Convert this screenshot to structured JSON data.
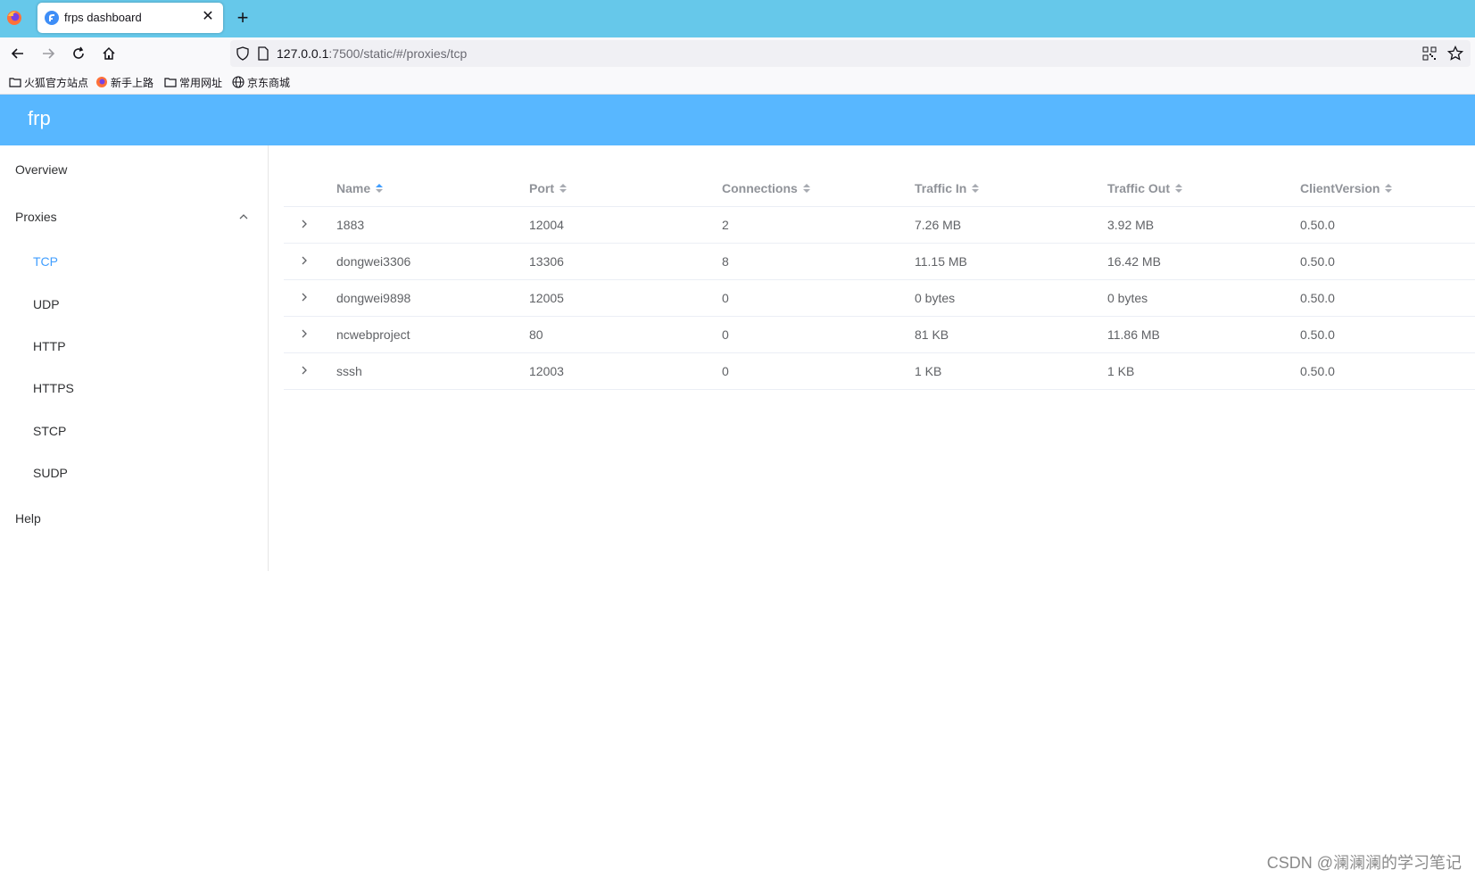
{
  "browser": {
    "tab_title": "frps dashboard",
    "tab_close": "✕",
    "new_tab": "+",
    "url_host": "127.0.0.1",
    "url_rest": ":7500/static/#/proxies/tcp",
    "bookmarks": [
      {
        "label": "火狐官方站点",
        "icon": "folder-icon"
      },
      {
        "label": "新手上路",
        "icon": "firefox-icon"
      },
      {
        "label": "常用网址",
        "icon": "folder-icon"
      },
      {
        "label": "京东商城",
        "icon": "globe-icon"
      }
    ]
  },
  "app": {
    "brand": "frp",
    "accent": "#58b7ff",
    "active_color": "#409eff"
  },
  "sidebar": {
    "overview": "Overview",
    "proxies": "Proxies",
    "sub_items": [
      "TCP",
      "UDP",
      "HTTP",
      "HTTPS",
      "STCP",
      "SUDP"
    ],
    "active": "TCP",
    "help": "Help"
  },
  "table": {
    "columns": [
      "Name",
      "Port",
      "Connections",
      "Traffic In",
      "Traffic Out",
      "ClientVersion"
    ],
    "sorted_column": "Name",
    "sort_direction": "ascending",
    "rows": [
      [
        "1883",
        "12004",
        "2",
        "7.26 MB",
        "3.92 MB",
        "0.50.0"
      ],
      [
        "dongwei3306",
        "13306",
        "8",
        "11.15 MB",
        "16.42 MB",
        "0.50.0"
      ],
      [
        "dongwei9898",
        "12005",
        "0",
        "0 bytes",
        "0 bytes",
        "0.50.0"
      ],
      [
        "ncwebproject",
        "80",
        "0",
        "81 KB",
        "11.86 MB",
        "0.50.0"
      ],
      [
        "sssh",
        "12003",
        "0",
        "1 KB",
        "1 KB",
        "0.50.0"
      ]
    ]
  },
  "watermark": "CSDN @澜澜澜的学习笔记"
}
